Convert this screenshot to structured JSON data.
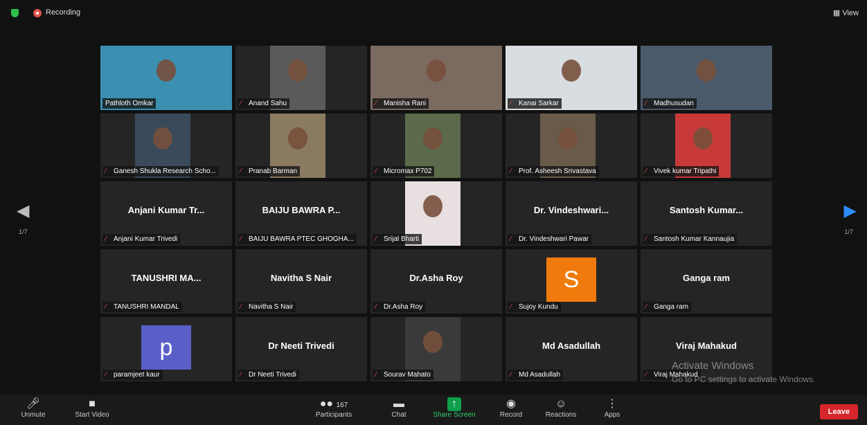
{
  "topbar": {
    "recording_label": "Recording",
    "view_label": "View"
  },
  "paging": {
    "left": "1/7",
    "right": "1/7"
  },
  "participants": [
    {
      "name": "Pathloth Omkar",
      "display": "",
      "active": true,
      "video": true,
      "mic_muted": false
    },
    {
      "name": "Anand Sahu",
      "display": "",
      "video": true,
      "mic_muted": true
    },
    {
      "name": "Manisha Rani",
      "display": "",
      "video": true,
      "mic_muted": true
    },
    {
      "name": "Kanai Sarkar",
      "display": "",
      "video": true,
      "mic_muted": true
    },
    {
      "name": "Madhusudan",
      "display": "",
      "video": true,
      "mic_muted": true
    },
    {
      "name": "Ganesh Shukla Research Scho...",
      "display": "",
      "video": true,
      "mic_muted": true
    },
    {
      "name": "Pranab Barman",
      "display": "",
      "video": true,
      "mic_muted": true
    },
    {
      "name": "Micromax P702",
      "display": "",
      "video": true,
      "mic_muted": true
    },
    {
      "name": "Prof. Asheesh Srivastava",
      "display": "",
      "video": true,
      "mic_muted": true
    },
    {
      "name": "Vivek kumar Tripathi",
      "display": "",
      "video": true,
      "mic_muted": true
    },
    {
      "name": "Anjani Kumar Trivedi",
      "display": "Anjani Kumar Tr...",
      "video": false,
      "mic_muted": true
    },
    {
      "name": "BAIJU BAWRA PTEC GHOGHA...",
      "display": "BAIJU BAWRA P...",
      "video": false,
      "mic_muted": true
    },
    {
      "name": "Srijal Bharti",
      "display": "",
      "video": true,
      "mic_muted": true
    },
    {
      "name": "Dr. Vindeshwari Pawar",
      "display": "Dr. Vindeshwari...",
      "video": false,
      "mic_muted": true
    },
    {
      "name": "Santosh Kumar Kannaujia",
      "display": "Santosh Kumar...",
      "video": false,
      "mic_muted": true
    },
    {
      "name": "TANUSHRI MANDAL",
      "display": "TANUSHRI MA...",
      "video": false,
      "mic_muted": true
    },
    {
      "name": "Navitha S Nair",
      "display": "Navitha S Nair",
      "video": false,
      "mic_muted": true
    },
    {
      "name": "Dr.Asha Roy",
      "display": "Dr.Asha Roy",
      "video": false,
      "mic_muted": true
    },
    {
      "name": "Sujoy Kundu",
      "display": "",
      "avatar": "S",
      "avatar_color": "#f07b0c",
      "video": false,
      "mic_muted": true
    },
    {
      "name": "Ganga ram",
      "display": "Ganga ram",
      "video": false,
      "mic_muted": true
    },
    {
      "name": "paramjeet kaur",
      "display": "",
      "avatar": "p",
      "avatar_color": "#5a5fc8",
      "video": false,
      "mic_muted": true
    },
    {
      "name": "Dr Neeti Trivedi",
      "display": "Dr Neeti Trivedi",
      "video": false,
      "mic_muted": true
    },
    {
      "name": "Sourav Mahato",
      "display": "",
      "video": true,
      "mic_muted": true
    },
    {
      "name": "Md Asadullah",
      "display": "Md Asadullah",
      "video": false,
      "mic_muted": true
    },
    {
      "name": "Viraj Mahakud",
      "display": "Viraj Mahakud",
      "video": false,
      "mic_muted": true
    }
  ],
  "toolbar": {
    "unmute": "Unmute",
    "start_video": "Start Video",
    "participants": "Participants",
    "participants_count": "167",
    "chat": "Chat",
    "share_screen": "Share Screen",
    "record": "Record",
    "reactions": "Reactions",
    "apps": "Apps",
    "leave": "Leave"
  },
  "watermark": {
    "line1": "Activate Windows",
    "line2": "Go to PC settings to activate Windows."
  }
}
